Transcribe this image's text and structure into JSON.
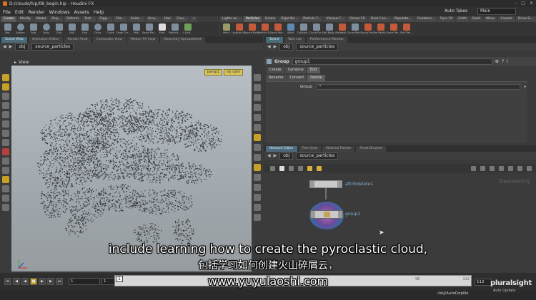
{
  "window": {
    "title": "D:/clouds/hip/08_begin.hip - Houdini FX"
  },
  "menu": {
    "items": [
      "File",
      "Edit",
      "Render",
      "Windows",
      "Assets",
      "Help"
    ],
    "auto_takes": "Auto Takes",
    "desktop": "Main"
  },
  "shelf_left": {
    "tabs": [
      "Create",
      "Modify",
      "Model",
      "Poly...",
      "Deform",
      "Text...",
      "Rigg...",
      "Cha...",
      "Anim...",
      "Grou...",
      "Hair",
      "Clou...",
      "+"
    ],
    "tools": [
      "Box",
      "Sphere",
      "Tube",
      "Torus",
      "Grid",
      "Null",
      "Line",
      "Circle",
      "Curve",
      "Draw Cur...",
      "Path",
      "Spray Pai...",
      "Font",
      "Platonic...",
      "L-Syst..."
    ]
  },
  "shelf_right": {
    "tabs": [
      "Lights an...",
      "Particles",
      "Grains",
      "Rigid Bo...",
      "Particle F...",
      "Viscous F...",
      "Ocean FX",
      "Fluid Con...",
      "Populate...",
      "Containe...",
      "Pyro FX",
      "Cloth",
      "Solid",
      "Wires",
      "Crowds",
      "Drive Si...",
      "+"
    ],
    "tools": [
      "Point",
      "Location P...",
      "Source Part...",
      "Particle Fi...",
      "Force Part...",
      "Wind",
      "Collision...",
      "Curve For...",
      "Soft Body...",
      "Metaball...",
      "Curve Part...",
      "Group Par...",
      "Sim Particl...",
      "Force Par...",
      "Sink Par..."
    ]
  },
  "viewport_pane": {
    "tabs": [
      "Scene View",
      "Animation Editor",
      "Render View",
      "Composite View",
      "Motion FX View",
      "Geometry Spreadsheet"
    ],
    "active_tab": 0,
    "path_root": "obj",
    "path_node": "source_particles",
    "title": "View",
    "camera": "persp1",
    "cam_mode": "no cam"
  },
  "param_pane": {
    "tabs": [
      "Scene",
      "Take List",
      "Performance Monitor"
    ],
    "path_root": "obj",
    "path_node": "source_particles",
    "node_type": "Group",
    "node_name": "group1",
    "sections": [
      "Create",
      "Combine",
      "Edit"
    ],
    "subtabs": [
      "Rename",
      "Convert",
      "Delete"
    ],
    "active_subtab": "Delete",
    "group_label": "Group",
    "group_value": "*"
  },
  "network_pane": {
    "tabs": [
      "Network Editor",
      "Tree View",
      "Material Palette",
      "Asset Browser"
    ],
    "path_root": "obj",
    "path_node": "source_particles",
    "watermark": "Geometry",
    "nodes": [
      {
        "name": "attribdelete1"
      },
      {
        "name": "group1"
      }
    ]
  },
  "timeline": {
    "frame": "1",
    "start": "1",
    "ruler_start": "1",
    "ruler_mid": "96",
    "end": "112",
    "end_field": "112"
  },
  "status": {
    "path": "/obj/AutoDopNe",
    "auto_update": "Auto Update"
  },
  "branding": {
    "logo_text": "pluralsight"
  },
  "subtitles": {
    "english": "include learning how to create the pyroclastic cloud,",
    "chinese": "包括学习如何创建火山碎屑云，",
    "website": "www.yuyulaoshi.com"
  },
  "colors": {
    "accent": "#c7a126",
    "viewport_top": "#b8bfc4",
    "viewport_bottom": "#969c9f",
    "node_label": "#7fb2d8",
    "particle": "#2a2d30"
  }
}
